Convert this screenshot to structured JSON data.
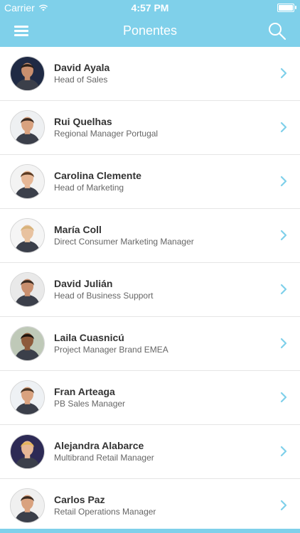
{
  "status": {
    "carrier": "Carrier",
    "time": "4:57 PM"
  },
  "header": {
    "title": "Ponentes"
  },
  "icons": {
    "menu": "hamburger-menu",
    "search": "magnifier",
    "chevron": "chevron-right"
  },
  "colors": {
    "accent": "#7fd0ea"
  },
  "speakers": [
    {
      "name": "David Ayala",
      "role": "Head of Sales"
    },
    {
      "name": "Rui Quelhas",
      "role": "Regional Manager Portugal"
    },
    {
      "name": "Carolina Clemente",
      "role": "Head of Marketing"
    },
    {
      "name": "María Coll",
      "role": "Direct Consumer Marketing Manager"
    },
    {
      "name": "David Julián",
      "role": "Head of Business Support"
    },
    {
      "name": "Laila Cuasnicú",
      "role": "Project Manager Brand EMEA"
    },
    {
      "name": "Fran Arteaga",
      "role": "PB Sales Manager"
    },
    {
      "name": "Alejandra Alabarce",
      "role": "Multibrand Retail Manager"
    },
    {
      "name": "Carlos Paz",
      "role": "Retail Operations Manager"
    }
  ]
}
